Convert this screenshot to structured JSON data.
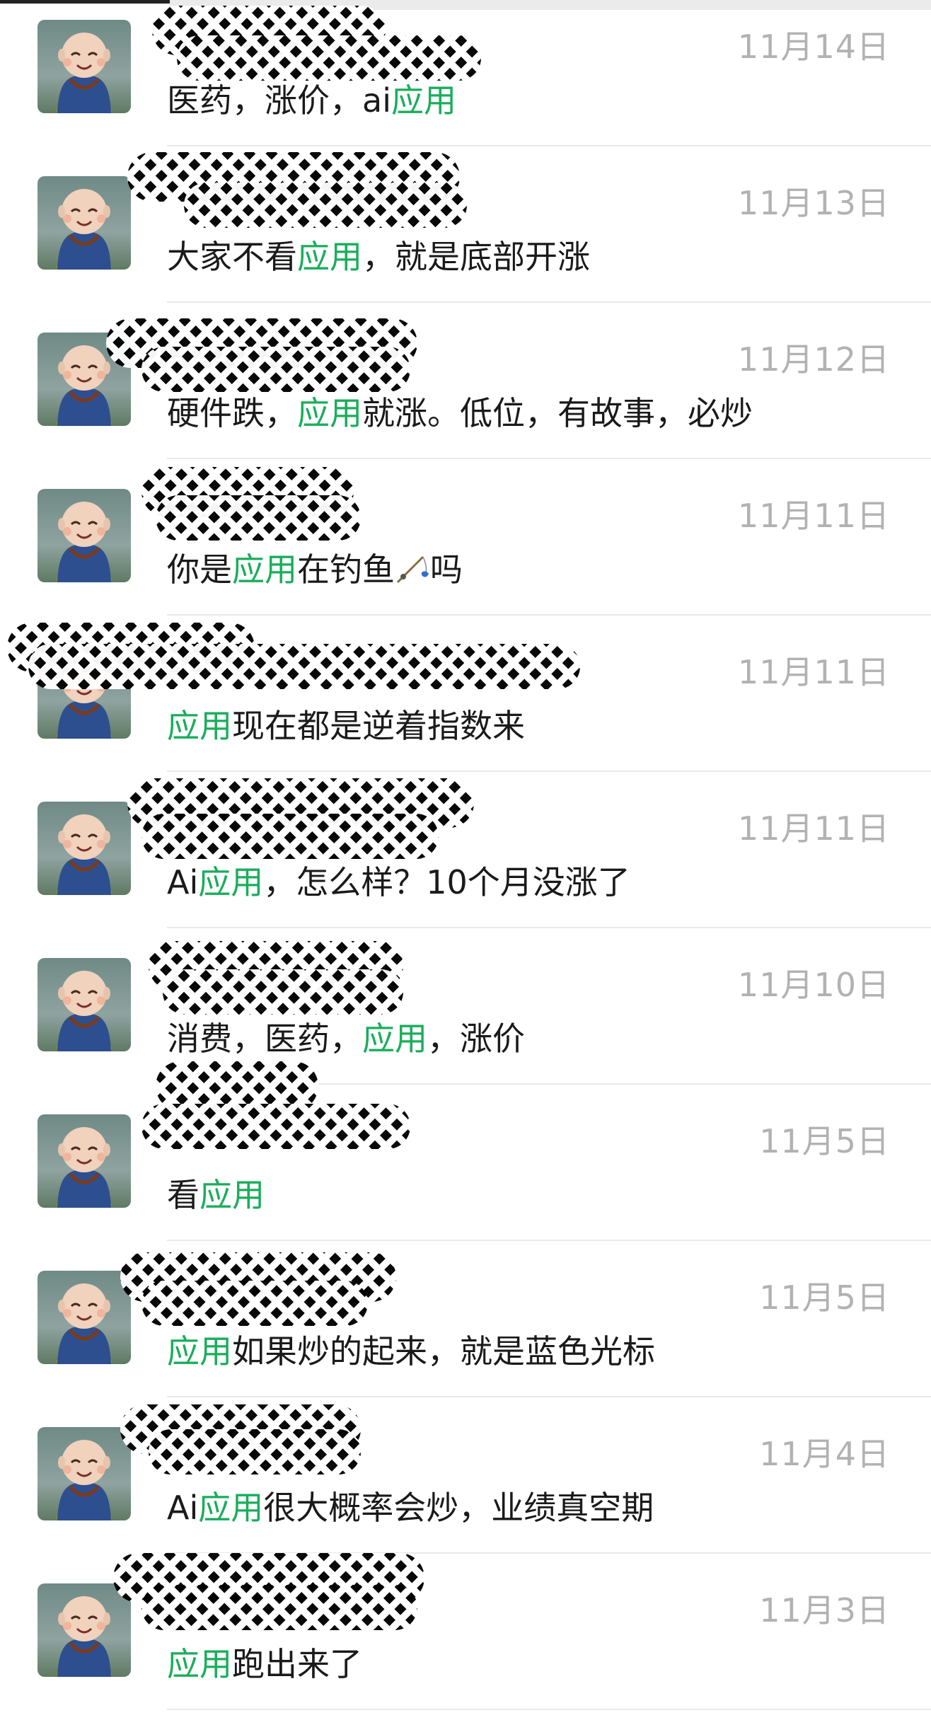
{
  "search_results": [
    {
      "date": "11月14日",
      "parts": [
        {
          "t": "医药，涨价，ai",
          "k": false
        },
        {
          "t": "应用",
          "k": true
        }
      ]
    },
    {
      "date": "11月13日",
      "parts": [
        {
          "t": "大家不看",
          "k": false
        },
        {
          "t": "应用",
          "k": true
        },
        {
          "t": "，就是底部开涨",
          "k": false
        }
      ]
    },
    {
      "date": "11月12日",
      "parts": [
        {
          "t": "硬件跌，",
          "k": false
        },
        {
          "t": "应用",
          "k": true
        },
        {
          "t": "就涨。低位，有故事，必炒",
          "k": false
        }
      ]
    },
    {
      "date": "11月11日",
      "parts": [
        {
          "t": "你是",
          "k": false
        },
        {
          "t": "应用",
          "k": true
        },
        {
          "t": "在钓鱼",
          "k": false
        },
        {
          "emoji": "fishing-rod-icon"
        },
        {
          "t": "吗",
          "k": false
        }
      ]
    },
    {
      "date": "11月11日",
      "parts": [
        {
          "t": "应用",
          "k": true
        },
        {
          "t": "现在都是逆着指数来",
          "k": false
        }
      ]
    },
    {
      "date": "11月11日",
      "parts": [
        {
          "t": "Ai",
          "k": false
        },
        {
          "t": "应用",
          "k": true
        },
        {
          "t": "，怎么样？10个月没涨了",
          "k": false
        }
      ]
    },
    {
      "date": "11月10日",
      "parts": [
        {
          "t": "消费，医药，",
          "k": false
        },
        {
          "t": "应用",
          "k": true
        },
        {
          "t": "，涨价",
          "k": false
        }
      ]
    },
    {
      "date": "11月5日",
      "parts": [
        {
          "t": "看",
          "k": false
        },
        {
          "t": "应用",
          "k": true
        }
      ]
    },
    {
      "date": "11月5日",
      "parts": [
        {
          "t": "应用",
          "k": true
        },
        {
          "t": "如果炒的起来，就是蓝色光标",
          "k": false
        }
      ]
    },
    {
      "date": "11月4日",
      "parts": [
        {
          "t": "Ai",
          "k": false
        },
        {
          "t": "应用",
          "k": true
        },
        {
          "t": "很大概率会炒，业绩真空期",
          "k": false
        }
      ]
    },
    {
      "date": "11月3日",
      "parts": [
        {
          "t": "应用",
          "k": true
        },
        {
          "t": "跑出来了",
          "k": false
        }
      ]
    }
  ],
  "colors": {
    "keyword_highlight": "#1aad5b",
    "date_text": "#b2b2b2",
    "message_text": "#1a1a1a",
    "divider": "#e9e9e9"
  }
}
